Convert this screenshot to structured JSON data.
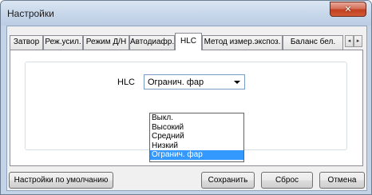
{
  "window": {
    "title": "Настройки",
    "close_glyph": "✕"
  },
  "tabs": [
    {
      "label": "Затвор",
      "active": false
    },
    {
      "label": "Реж.усил.",
      "active": false
    },
    {
      "label": "Режим Д/Н",
      "active": false
    },
    {
      "label": "Автодиафр.",
      "active": false
    },
    {
      "label": "HLC",
      "active": true
    },
    {
      "label": "Метод измер.экспоз.",
      "active": false
    },
    {
      "label": "Баланс бел.",
      "active": false
    }
  ],
  "tab_scroll": {
    "left": "◂",
    "right": "▸"
  },
  "hlc": {
    "label": "HLC",
    "selected": "Огранич. фар",
    "options": [
      "Выкл.",
      "Высокий",
      "Средний",
      "Низкий",
      "Огранич. фар"
    ]
  },
  "buttons": {
    "defaults": "Настройки по умолчанию",
    "save": "Сохранить",
    "reset": "Сброс",
    "cancel": "Отмена"
  }
}
